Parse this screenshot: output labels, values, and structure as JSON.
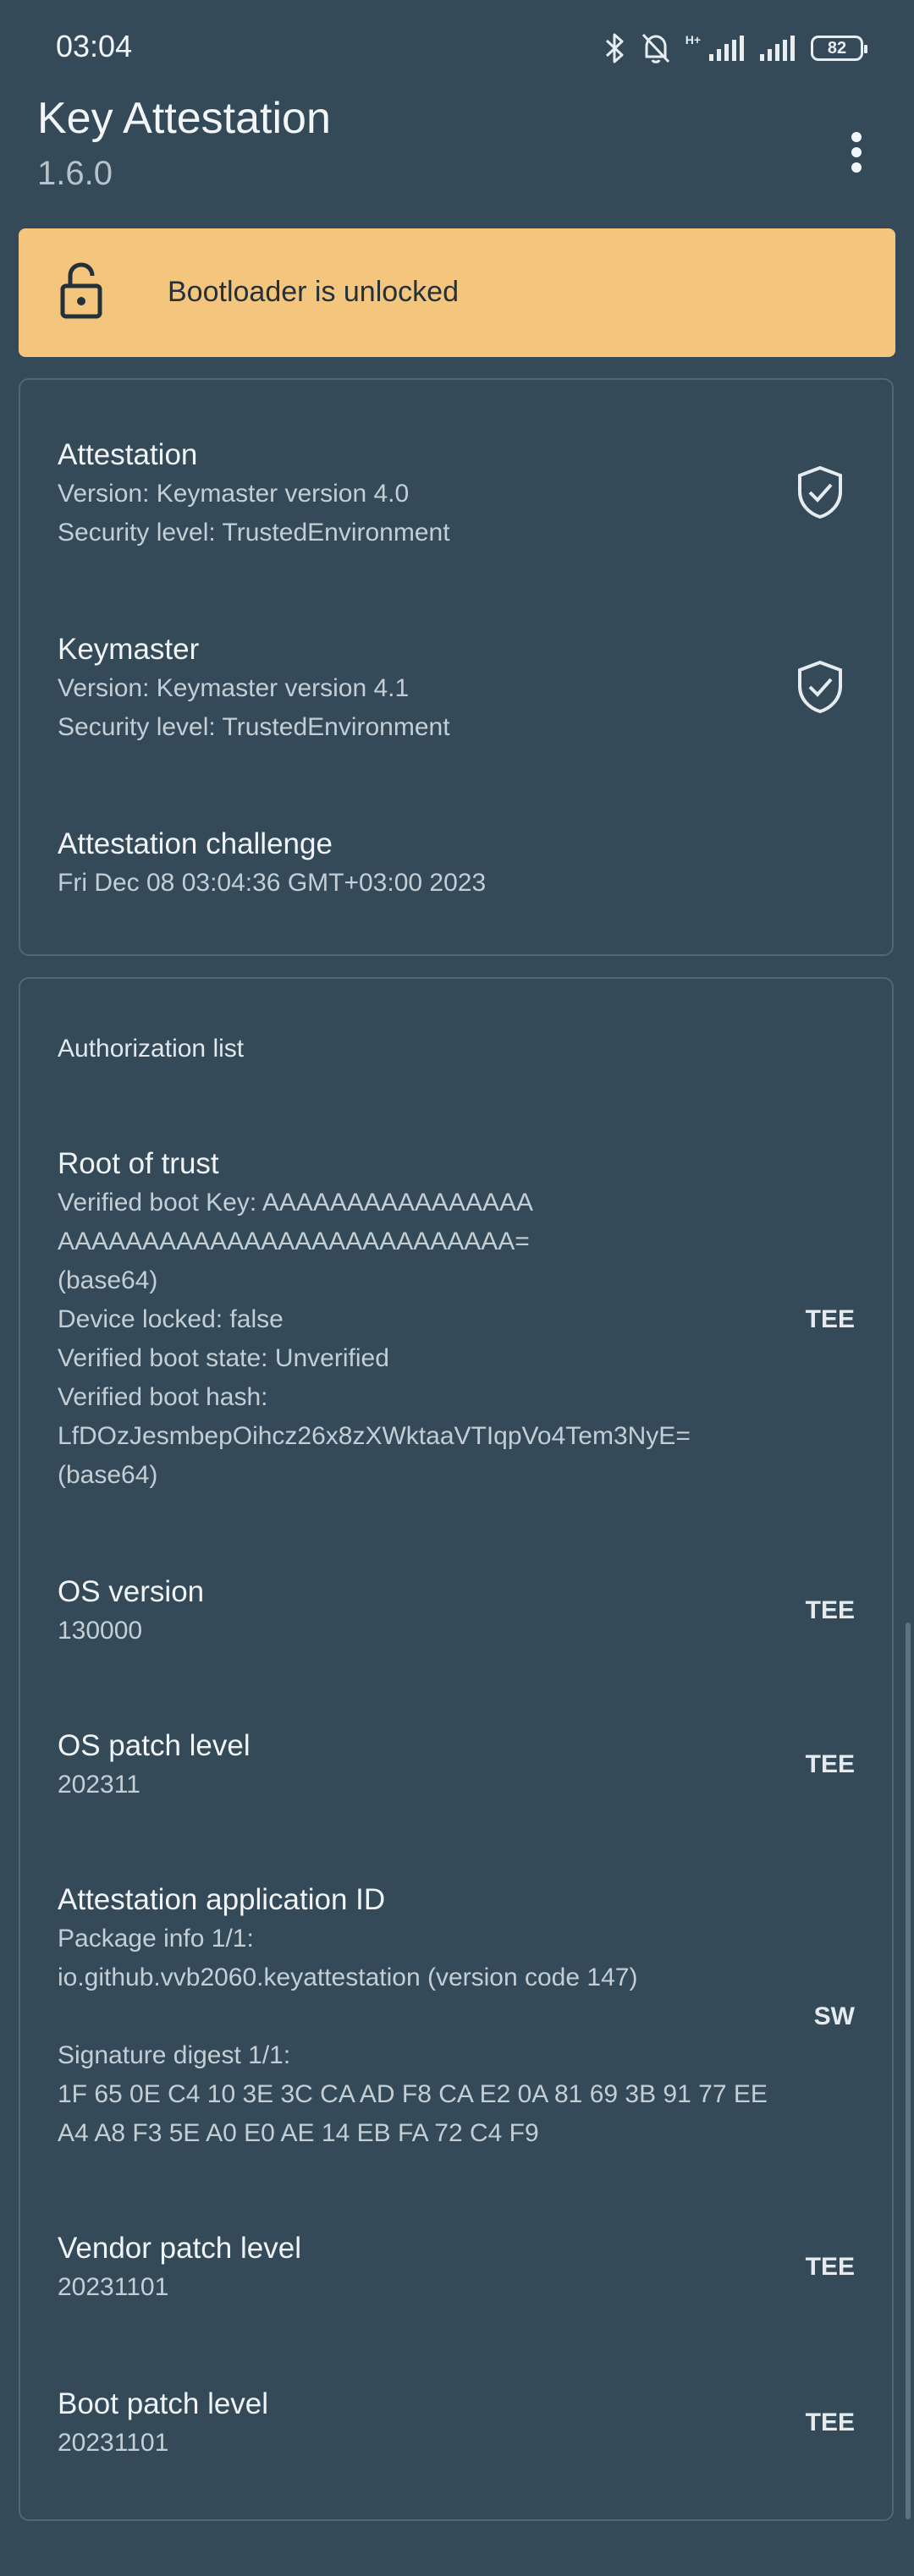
{
  "status_bar": {
    "time": "03:04",
    "network_label": "H+",
    "battery": "82"
  },
  "app_bar": {
    "title": "Key Attestation",
    "version": "1.6.0"
  },
  "banner": {
    "text": "Bootloader is unlocked",
    "color": "#f3c57d"
  },
  "attestation": {
    "title": "Attestation",
    "version": "Version: Keymaster version 4.0",
    "security": "Security level: TrustedEnvironment"
  },
  "keymaster": {
    "title": "Keymaster",
    "version": "Version: Keymaster version 4.1",
    "security": "Security level: TrustedEnvironment"
  },
  "challenge": {
    "title": "Attestation challenge",
    "value": "Fri Dec 08 03:04:36 GMT+03:00 2023"
  },
  "auth_list": {
    "header": "Authorization list",
    "root_of_trust": {
      "title": "Root of trust",
      "lines": [
        "Verified boot Key: AAAAAAAAAAAAAAAA",
        "AAAAAAAAAAAAAAAAAAAAAAAAAAA=",
        "(base64)",
        "Device locked: false",
        "Verified boot state: Unverified",
        "Verified boot hash:",
        "LfDOzJesmbepOihcz26x8zXWktaaVTIqpVo4Tem3NyE=",
        "(base64)"
      ],
      "tag": "TEE"
    },
    "os_version": {
      "title": "OS version",
      "value": "130000",
      "tag": "TEE"
    },
    "os_patch": {
      "title": "OS patch level",
      "value": "202311",
      "tag": "TEE"
    },
    "app_id": {
      "title": "Attestation application ID",
      "pkg_label": "Package info 1/1:",
      "pkg_value": "io.github.vvb2060.keyattestation (version code 147)",
      "sig_label": "Signature digest 1/1:",
      "sig_line1": "1F 65 0E C4 10 3E 3C CA AD F8 CA E2 0A 81 69 3B 91 77 EE",
      "sig_line2": "A4 A8 F3 5E A0 E0 AE 14 EB FA 72 C4 F9",
      "tag": "SW"
    },
    "vendor_patch": {
      "title": "Vendor patch level",
      "value": "20231101",
      "tag": "TEE"
    },
    "boot_patch": {
      "title": "Boot patch level",
      "value": "20231101",
      "tag": "TEE"
    }
  },
  "icons": {
    "bluetooth": "bluetooth-icon",
    "bell_off": "bell-off-icon",
    "signal": "signal-icon",
    "battery": "battery-icon",
    "more": "more-vert-icon",
    "lock": "lock-open-icon",
    "shield": "shield-check-icon"
  }
}
